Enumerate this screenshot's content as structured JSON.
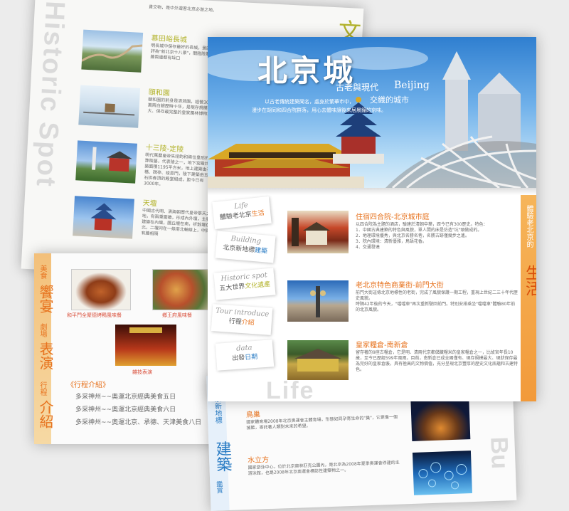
{
  "back_page": {
    "side_text": "Historic Spot",
    "corner_char": "文",
    "top_snippet": "貴交物，是中外遊客北京必遊之地。",
    "spots": [
      {
        "title": "慕田峪長城",
        "desc": "明長城中保存最好的長城，景區，被評為\"新北京十八景\"，關隘險要，城牆兩邊都有垛口"
      },
      {
        "title": "頤和園",
        "desc": "頤和園的前身是清漪園，經營3000萬兩白銀歷時十年，是現存規模最大、保存最完整的皇家園林博物館"
      },
      {
        "title": "十三陵-定陵",
        "desc": "明代萬曆皇帝朱翊鈞和兩位皇后的合葬陵墓，代表陵之一，地下宮殿共建築面積1195平方米，地上建築由石橋、碑亭、祾恩門，陵下建築由五座石拱券頂的殿堂組成，距今已有3000年。"
      },
      {
        "title": "天壇",
        "desc": "中國古代明、清兩朝歷代皇帝祭天之地，有兩重圍牆，形成內外壇，主要建築在內壇，圜丘壇在南，祈穀壇在北，二壇同在一條南北軸線上，中間有牆相隔"
      }
    ]
  },
  "food_page": {
    "side_label_1": "美食",
    "side_label_big_1": "饗宴",
    "side_label_2": "劇場",
    "side_label_big_2": "表演",
    "side_label_3": "行程",
    "side_label_big_3": "介紹",
    "captions": [
      "和平門全聚德烤鴨風味餐",
      "鄉王府風味餐",
      "雜技表演"
    ],
    "itinerary_title": "《行程介紹》",
    "itinerary_items": [
      "多采神州~~奧運北京經典美食五日",
      "多采神州~~奧運北京經典美食六日",
      "多采神州~~奧運北京、承德、天津美食八日"
    ]
  },
  "main_page": {
    "banner_title": "北京城",
    "banner_subtitle": "古老與現代",
    "banner_subtitle_en": "Beijing",
    "banner_subtitle_2": "交織的城市",
    "banner_line_1": "以古老傳統建築聞名，處身於繁華市中，",
    "banner_line_2": "漫步在胡同和四合院群落，用心去體味讓後來居晨鐘的京味。",
    "nav_tabs": [
      {
        "en": "Life",
        "zh_a": "體驗老北京",
        "zh_b": "生活"
      },
      {
        "en": "Building",
        "zh_a": "北京新地標",
        "zh_b": "建築"
      },
      {
        "en": "Historic spot",
        "zh_a": "五大世界",
        "zh_b": "文化遺產"
      },
      {
        "en": "Tour introduce",
        "zh_a": "行程",
        "zh_b": "介紹"
      },
      {
        "en": "data",
        "zh_a": "出發",
        "zh_b": "日期"
      }
    ],
    "side_label_small": "體驗老北京的",
    "side_label_big": "生活",
    "life_watermark": "Life",
    "items": [
      {
        "title": "住宿四合院-北京城市庭",
        "desc": "以四合院為主題的酒店，驗建於清朝中葉，距今已有300歷史。特色：\n1．中國古典建築的特色與風貌，單人間的床是仿造\"坑\"頭做成的。\n2．地理環境優秀，與北京名勝名巷，名勝古跡僅幾步之遙。\n3．院內環境：清新優雅，鳥語花香。\n4．交通發達"
      },
      {
        "title": "老北京特色商業街-前門大街",
        "desc": "前門大街這條北京地標性的老街，完成了風貌保護一期工程，重現上世紀二三十年代歷史風貌。\n時隔42年後的今天，\"噹噹車\"再次重新駛回前門。特別安排乘坐\"噹噹車\"體驗80年前的北京風貌。"
      },
      {
        "title": "皇家糧倉-南新倉",
        "desc": "留存著的9座古糧倉，它是明、清兩代京都儲藏糧米的皇家糧倉之一，比故宮年長10歲，至今已歷經599年風雨。目前，南新倉已成全國僅有、現存規模最大、現狀保存最為完好的皇家倉廒，具有極高的文物價值，充分呈現北京豐厚的歷史文化底蘊和古建特色。"
      }
    ]
  },
  "bottom_page": {
    "side_label_small": "北京新地標",
    "side_label_big": "建築",
    "side_tail": "鑑賞",
    "watermark": "Bu",
    "items": [
      {
        "title": "鳥巢",
        "desc": "國家體育場2008年北京奧運會主體育場，形態如同孕育生命的\"巢\"，它更像一個搖籃，寄託著人類對未來的希望。"
      },
      {
        "title": "水立方",
        "desc": "國家游泳中心，位於北京奧林匹克公園內，是北京為2008年夏季奧運會修建的主游泳館，也是2008年北京奧運會標誌性建築物之一。"
      }
    ]
  },
  "colors": {
    "orange": "#e7731f",
    "olive": "#b3b32c",
    "blue": "#2a7cc4",
    "tan": "#c0a24a"
  }
}
